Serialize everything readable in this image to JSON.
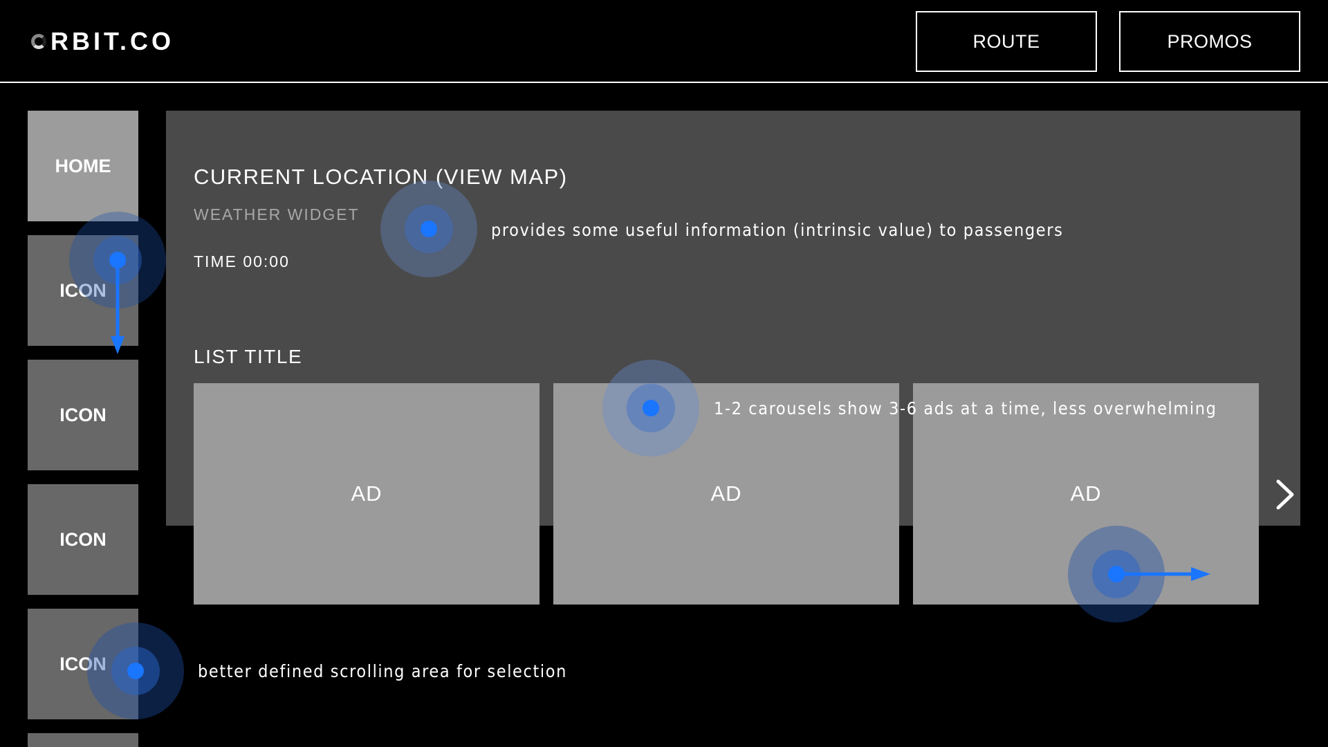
{
  "header": {
    "logo_text": "RBIT.CO",
    "buttons": [
      {
        "label": "ROUTE"
      },
      {
        "label": "PROMOS"
      }
    ]
  },
  "sidebar": {
    "items": [
      {
        "label": "HOME",
        "active": true
      },
      {
        "label": "ICON"
      },
      {
        "label": "ICON"
      },
      {
        "label": "ICON"
      },
      {
        "label": "ICON"
      }
    ]
  },
  "main": {
    "location_title": "CURRENT LOCATION (VIEW MAP)",
    "weather_label": "WEATHER WIDGET",
    "time_label": "TIME 00:00",
    "list_title": "LIST TITLE",
    "ads": [
      {
        "label": "AD"
      },
      {
        "label": "AD"
      },
      {
        "label": "AD"
      }
    ],
    "next_icon": "chevron-right-icon"
  },
  "annotations": {
    "weather_note": "provides some useful information (intrinsic value) to passengers",
    "carousel_note": "1-2 carousels show 3-6 ads at a time, less overwhelming",
    "scroll_note": "better defined scrolling area for selection"
  },
  "colors": {
    "background": "#000000",
    "panel": "#4a4a4a",
    "ad_tile": "#9b9b9b",
    "sidebar_active": "#9c9c9c",
    "sidebar_item": "#686868",
    "touch_accent": "#1a75ff"
  }
}
